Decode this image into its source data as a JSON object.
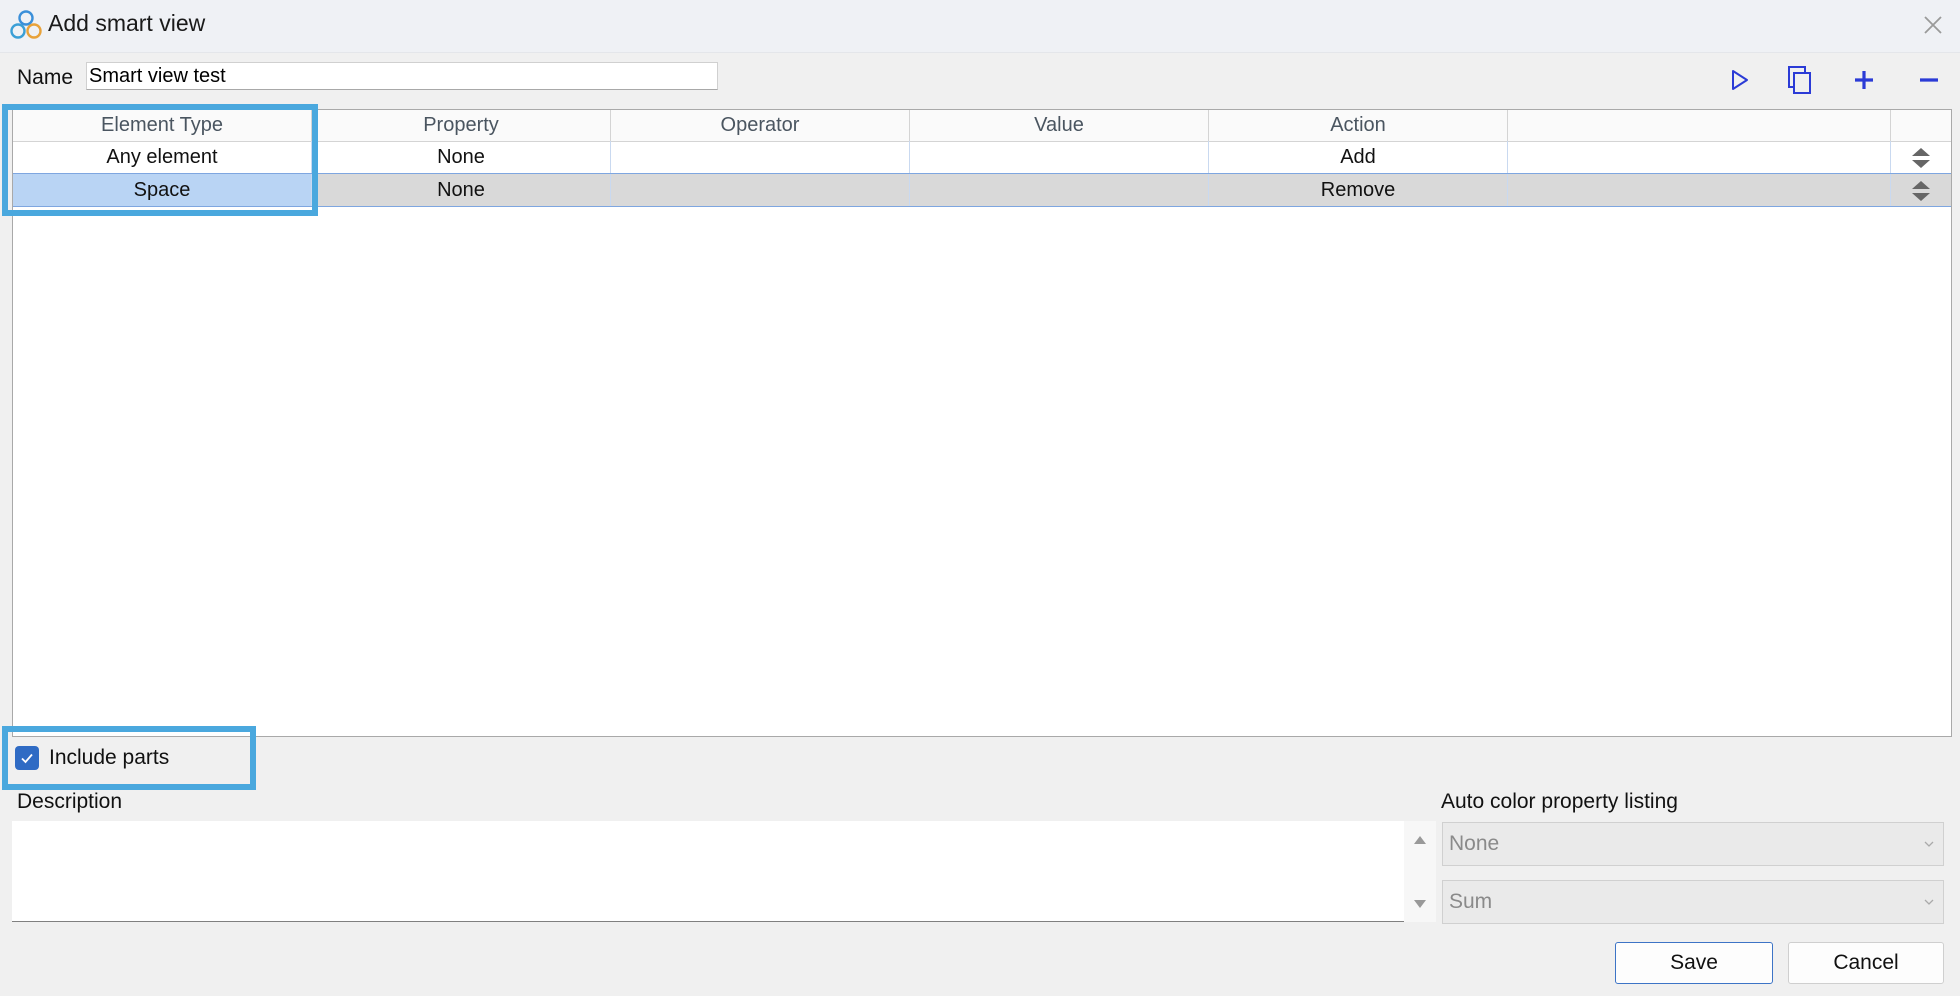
{
  "window": {
    "title": "Add smart view",
    "icon": "smart-view-logo-icon",
    "close_icon": "close-icon"
  },
  "name": {
    "label": "Name",
    "value": "Smart view test"
  },
  "toolbar": {
    "icons": [
      "play-icon",
      "copy-icon",
      "plus-icon",
      "minus-icon"
    ],
    "accent_color": "#2b3bd6"
  },
  "grid": {
    "columns": [
      "Element Type",
      "Property",
      "Operator",
      "Value",
      "Action",
      ""
    ],
    "rows": [
      {
        "element_type": "Any element",
        "property": "None",
        "operator": "",
        "value": "",
        "action": "Add",
        "extra": "",
        "selected": false
      },
      {
        "element_type": "Space",
        "property": "None",
        "operator": "",
        "value": "",
        "action": "Remove",
        "extra": "",
        "selected": true
      }
    ],
    "row_handle_icon": "reorder-arrows-icon"
  },
  "include_parts": {
    "label": "Include parts",
    "checked": true
  },
  "description": {
    "label": "Description",
    "value": ""
  },
  "auto_color": {
    "label": "Auto color property listing",
    "property_value": "None",
    "aggregate_value": "Sum"
  },
  "buttons": {
    "save": "Save",
    "cancel": "Cancel"
  },
  "colors": {
    "highlight_callout": "#4aa8de",
    "selection": "#b9d4f4",
    "checkbox": "#2f6bc4"
  }
}
